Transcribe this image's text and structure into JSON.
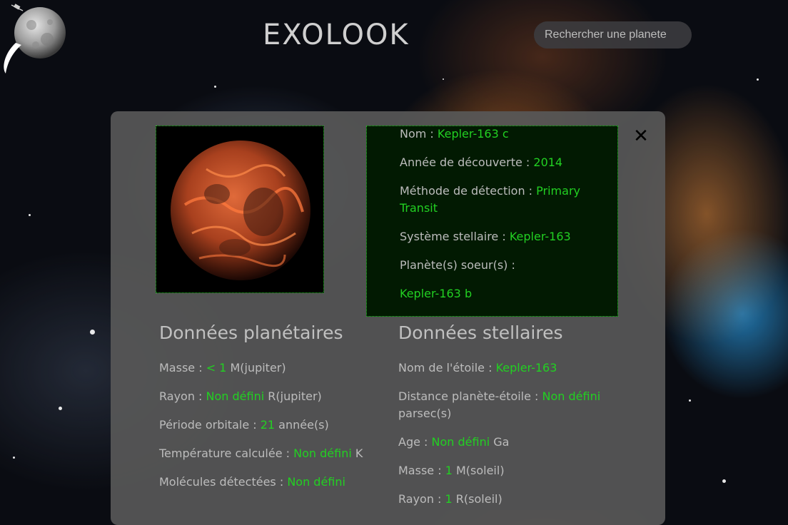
{
  "header": {
    "title": "EXOLOOK",
    "search_placeholder": "Rechercher une planete"
  },
  "planet_info": {
    "name_label": "Nom : ",
    "name_value": "Kepler-163 c",
    "year_label": "Année de découverte : ",
    "year_value": "2014",
    "method_label": "Méthode de détection : ",
    "method_value_1": "Primary",
    "method_value_2": "Transit",
    "system_label": "Système stellaire : ",
    "system_value": "Kepler-163",
    "sisters_label": "Planète(s) soeur(s) :",
    "sisters_value": "Kepler-163 b"
  },
  "close_label": "✕",
  "planetary": {
    "heading": "Données planétaires",
    "mass_label": "Masse : ",
    "mass_value": "< 1",
    "mass_unit": " M(jupiter)",
    "radius_label": "Rayon : ",
    "radius_value": "Non défini",
    "radius_unit": " R(jupiter)",
    "period_label": "Période orbitale : ",
    "period_value": "21",
    "period_unit": " année(s)",
    "temp_label": "Température calculée : ",
    "temp_value": "Non défini",
    "temp_unit": " K",
    "molecules_label": "Molécules détectées : ",
    "molecules_value": "Non défini"
  },
  "stellar": {
    "heading": "Données stellaires",
    "star_label": "Nom de l'étoile : ",
    "star_value": "Kepler-163",
    "distance_label": "Distance planète-étoile : ",
    "distance_value": "Non défini",
    "distance_unit": "parsec(s)",
    "age_label": "Age : ",
    "age_value": "Non défini",
    "age_unit": " Ga",
    "mass_label": "Masse : ",
    "mass_value": "1",
    "mass_unit": " M(soleil)",
    "radius_label": "Rayon : ",
    "radius_value": "1",
    "radius_unit": " R(soleil)"
  },
  "colors": {
    "accent_green": "#22d022",
    "panel": "#585858",
    "text": "#bcbcbc"
  },
  "icons": {
    "logo": "moon-logo-icon",
    "close": "close-icon"
  }
}
